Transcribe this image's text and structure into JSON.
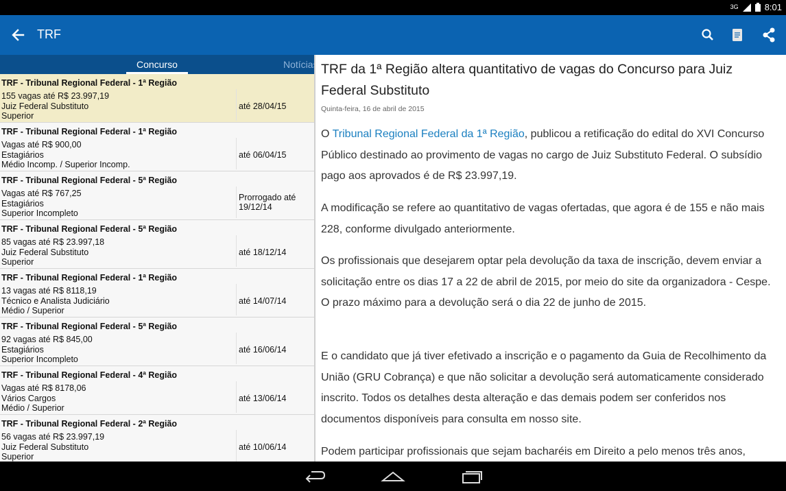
{
  "status": {
    "signal": "3G",
    "time": "8:01"
  },
  "appbar": {
    "title": "TRF"
  },
  "tabs": [
    {
      "label": "Concurso"
    },
    {
      "label": "Notícias"
    }
  ],
  "list": [
    {
      "title": "TRF - Tribunal Regional Federal - 1ª Região",
      "vagas": "155 vagas até R$ 23.997,19",
      "cargo": "Juiz Federal Substituto",
      "nivel": "Superior",
      "date": "até 28/04/15"
    },
    {
      "title": "TRF - Tribunal Regional Federal - 1ª Região",
      "vagas": "Vagas até R$ 900,00",
      "cargo": "Estagiários",
      "nivel": "Médio Incomp. / Superior Incomp.",
      "date": "até 06/04/15"
    },
    {
      "title": "TRF - Tribunal Regional Federal - 5ª Região",
      "vagas": "Vagas até R$ 767,25",
      "cargo": "Estagiários",
      "nivel": "Superior Incompleto",
      "date_line1": "Prorrogado até",
      "date_line2": "19/12/14"
    },
    {
      "title": "TRF - Tribunal Regional Federal - 5ª Região",
      "vagas": "85 vagas até R$ 23.997,18",
      "cargo": "Juiz Federal Substituto",
      "nivel": "Superior",
      "date": "até 18/12/14"
    },
    {
      "title": "TRF - Tribunal Regional Federal - 1ª Região",
      "vagas": "13 vagas até R$ 8118,19",
      "cargo": "Técnico e Analista Judiciário",
      "nivel": "Médio / Superior",
      "date": "até 14/07/14"
    },
    {
      "title": "TRF - Tribunal Regional Federal - 5ª Região",
      "vagas": "92 vagas até R$ 845,00",
      "cargo": "Estagiários",
      "nivel": "Superior Incompleto",
      "date": "até 16/06/14"
    },
    {
      "title": "TRF - Tribunal Regional Federal - 4ª Região",
      "vagas": "Vagas até R$ 8178,06",
      "cargo": "Vários Cargos",
      "nivel": "Médio / Superior",
      "date": "até 13/06/14"
    },
    {
      "title": "TRF - Tribunal Regional Federal - 2ª Região",
      "vagas": "56 vagas até R$ 23.997,19",
      "cargo": "Juiz Federal Substituto",
      "nivel": "Superior",
      "date": "até 10/06/14"
    }
  ],
  "article": {
    "title": "TRF da 1ª Região altera quantitativo de vagas do Concurso para Juiz Federal Substituto",
    "date": "Quinta-feira, 16 de abril de 2015",
    "p1_pre": "O ",
    "p1_link": "Tribunal Regional Federal da 1ª Região",
    "p1_post": ", publicou a retificação do edital do XVI Concurso Público destinado ao provimento de vagas no cargo de Juiz Substituto Federal. O subsídio pago aos aprovados é de R$ 23.997,19.",
    "p2": "A modificação se refere ao quantitativo de vagas ofertadas, que agora é de 155 e não mais 228, conforme divulgado anteriormente.",
    "p3": "Os profissionais que desejarem optar pela devolução da taxa de inscrição, devem enviar a solicitação entre os dias 17 a 22 de abril de 2015, por meio do site da organizadora - Cespe. O prazo máximo para a devolução será o dia 22 de junho de 2015.",
    "p4": "E o candidato que já tiver efetivado a inscrição e o pagamento da Guia de Recolhimento da União (GRU Cobrança) e que não solicitar a devolução será automaticamente considerado inscrito. Todos os detalhes desta alteração e das demais podem ser conferidos nos documentos disponíveis para consulta em nosso site.",
    "p5": "Podem participar profissionais que sejam bacharéis em Direito a pelo menos três anos,"
  },
  "colors": {
    "appbar": "#0b63b1",
    "tabs": "#0b4f8c",
    "selected_row": "#f2ecc8",
    "link": "#1a7fc0"
  }
}
